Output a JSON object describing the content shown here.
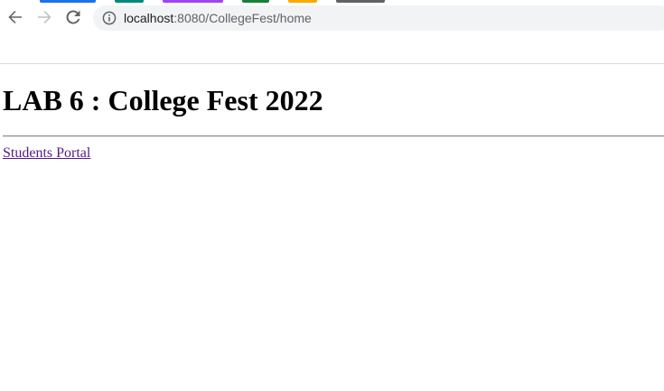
{
  "browser": {
    "url_host": "localhost",
    "url_rest": ":8080/CollegeFest/home",
    "back_icon": "back-arrow-icon",
    "forward_icon": "forward-arrow-icon",
    "reload_icon": "reload-icon",
    "info_icon": "info-icon",
    "tab_colors": [
      "#1a73e8",
      "#00897b",
      "#a142f4",
      "#188038",
      "#f9ab00",
      "#5f6368"
    ]
  },
  "page": {
    "title": "LAB 6 : College Fest 2022",
    "link_label": "Students Portal",
    "link_color": "#551a8b"
  }
}
